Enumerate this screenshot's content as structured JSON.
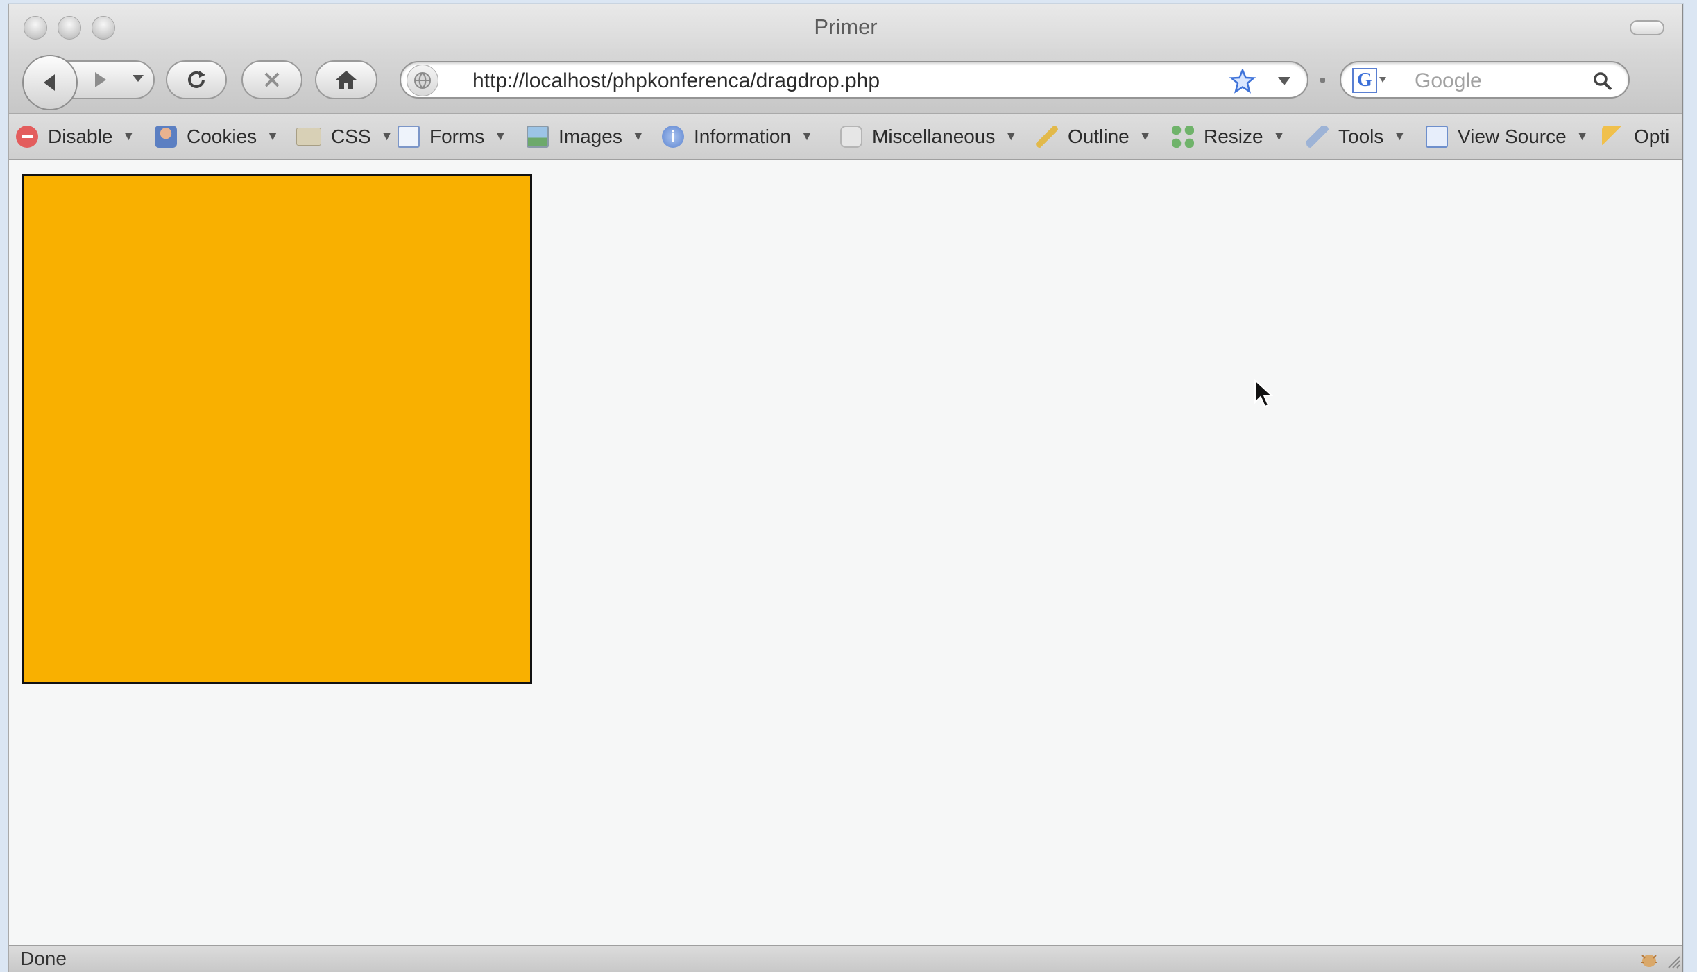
{
  "window": {
    "title": "Primer"
  },
  "nav": {
    "url": "http://localhost/phpkonferenca/dragdrop.php",
    "search_placeholder": "Google"
  },
  "toolbar": {
    "items": [
      {
        "label": "Disable",
        "icon": "disable-icon"
      },
      {
        "label": "Cookies",
        "icon": "cookies-icon"
      },
      {
        "label": "CSS",
        "icon": "css-icon"
      },
      {
        "label": "Forms",
        "icon": "forms-icon"
      },
      {
        "label": "Images",
        "icon": "images-icon"
      },
      {
        "label": "Information",
        "icon": "information-icon"
      },
      {
        "label": "Miscellaneous",
        "icon": "miscellaneous-icon"
      },
      {
        "label": "Outline",
        "icon": "outline-icon"
      },
      {
        "label": "Resize",
        "icon": "resize-icon"
      },
      {
        "label": "Tools",
        "icon": "tools-icon"
      },
      {
        "label": "View Source",
        "icon": "view-source-icon"
      },
      {
        "label": "Opti",
        "icon": "options-icon"
      }
    ]
  },
  "page": {
    "box_color": "#f9b000"
  },
  "status": {
    "text": "Done"
  }
}
